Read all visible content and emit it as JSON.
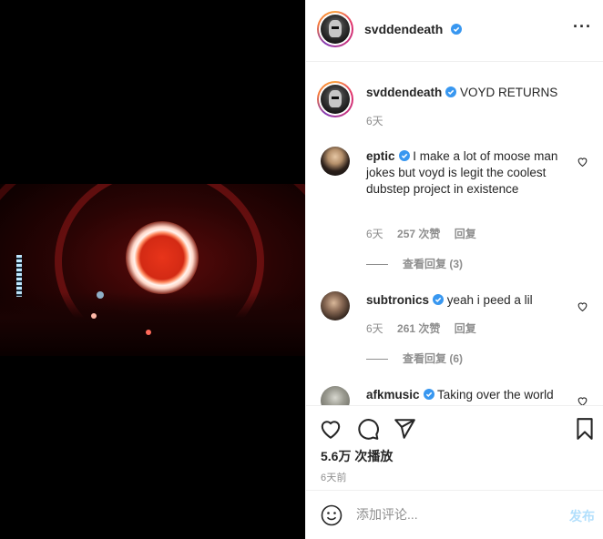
{
  "post": {
    "username": "svddendeath",
    "caption": "VOYD RETURNS",
    "caption_time": "6天",
    "views": "5.6万 次播放",
    "posted_ago": "6天前"
  },
  "comments": [
    {
      "username": "eptic",
      "text": "I make a lot of moose man jokes but voyd is legit the coolest dubstep project in existence",
      "time": "6天",
      "likes": "257 次赞",
      "reply_label": "回复",
      "view_replies": "查看回复 (3)"
    },
    {
      "username": "subtronics",
      "text": "yeah i peed a lil",
      "time": "6天",
      "likes": "261 次赞",
      "reply_label": "回复",
      "view_replies": "查看回复 (6)"
    },
    {
      "username": "afkmusic",
      "text": "Taking over the world"
    }
  ],
  "add_comment": {
    "placeholder": "添加评论...",
    "post_label": "发布"
  },
  "icons": [
    "more-icon",
    "verified-icon",
    "heart-icon",
    "comment-icon",
    "share-icon",
    "bookmark-icon",
    "emoji-icon"
  ],
  "colors": {
    "verified": "#3897f0",
    "post_button": "#b2dffc",
    "muted": "#8e8e8e"
  }
}
